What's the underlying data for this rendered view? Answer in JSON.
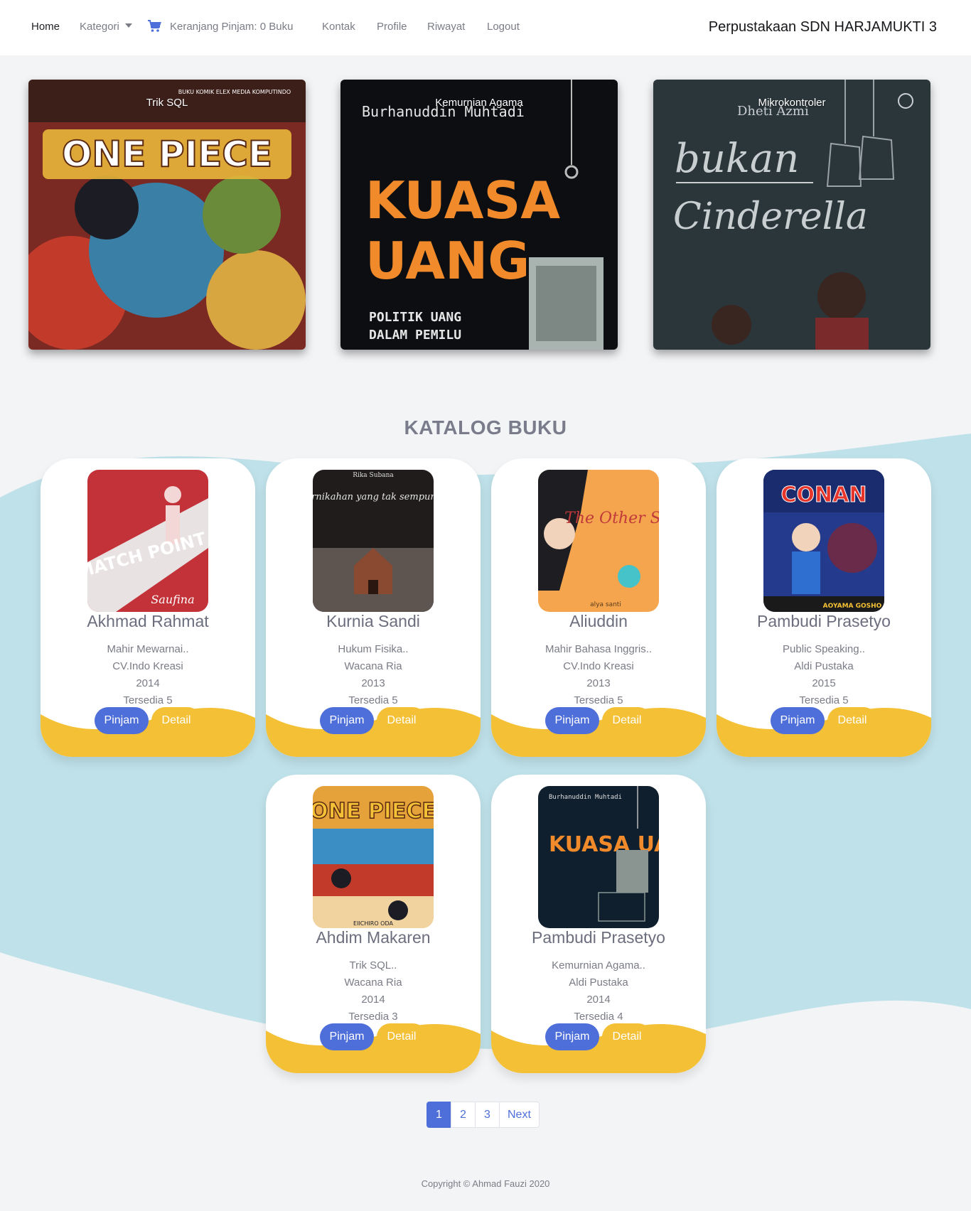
{
  "nav": {
    "home": "Home",
    "kategori": "Kategori",
    "cart": "Keranjang Pinjam: 0 Buku",
    "kontak": "Kontak",
    "profile": "Profile",
    "riwayat": "Riwayat",
    "logout": "Logout",
    "brand": "Perpustakaan SDN HARJAMUKTI 3",
    "cart_icon": "cart-icon"
  },
  "carousel": [
    {
      "caption": "Trik SQL",
      "cover_text": "ONE PIECE",
      "cover_sub": "BUKU KOMIK ELEX MEDIA KOMPUTINDO"
    },
    {
      "caption": "Kemurnian Agama",
      "cover_author": "Burhanuddin Muhtadi",
      "cover_title_1": "KUASA",
      "cover_title_2": "UANG",
      "cover_sub_1": "POLITIK UANG",
      "cover_sub_2": "DALAM PEMILU"
    },
    {
      "caption": "Mikrokontroler",
      "cover_author": "Dheti Azmi",
      "cover_title_1": "bukan",
      "cover_title_2": "Cinderella"
    }
  ],
  "section_title": "KATALOG BUKU",
  "books": [
    {
      "author": "Akhmad Rahmat",
      "title": "Mahir Mewarnai..",
      "publisher": "CV.Indo Kreasi",
      "year": "2014",
      "stock": "Tersedia 5",
      "cover_title": "MATCH POINT",
      "cover_author": "Saufina"
    },
    {
      "author": "Kurnia Sandi",
      "title": "Hukum Fisika..",
      "publisher": "Wacana Ria",
      "year": "2013",
      "stock": "Tersedia 5",
      "cover_title": "Pernikahan yang tak sempurna",
      "cover_author": "Rika Subana"
    },
    {
      "author": "Aliuddin",
      "title": "Mahir Bahasa Inggris..",
      "publisher": "CV.Indo Kreasi",
      "year": "2013",
      "stock": "Tersedia 5",
      "cover_title": "The Other Side",
      "cover_author": "alya santi"
    },
    {
      "author": "Pambudi Prasetyo",
      "title": "Public Speaking..",
      "publisher": "Aldi Pustaka",
      "year": "2015",
      "stock": "Tersedia 5",
      "cover_title": "CONAN",
      "cover_author": "AOYAMA GOSHO"
    },
    {
      "author": "Ahdim Makaren",
      "title": "Trik SQL..",
      "publisher": "Wacana Ria",
      "year": "2014",
      "stock": "Tersedia 3",
      "cover_title": "ONE PIECE",
      "cover_author": "EIICHIRO ODA"
    },
    {
      "author": "Pambudi Prasetyo",
      "title": "Kemurnian Agama..",
      "publisher": "Aldi Pustaka",
      "year": "2014",
      "stock": "Tersedia 4",
      "cover_title": "KUASA UANG",
      "cover_author": "Burhanuddin Muhtadi"
    }
  ],
  "buttons": {
    "pinjam": "Pinjam",
    "detail": "Detail"
  },
  "pagination": [
    "1",
    "2",
    "3",
    "Next"
  ],
  "footer": "Copyright © Ahmad Fauzi 2020",
  "colors": {
    "primary": "#4e6fd9",
    "accent": "#f4c035",
    "wave": "#bfe1e9"
  }
}
